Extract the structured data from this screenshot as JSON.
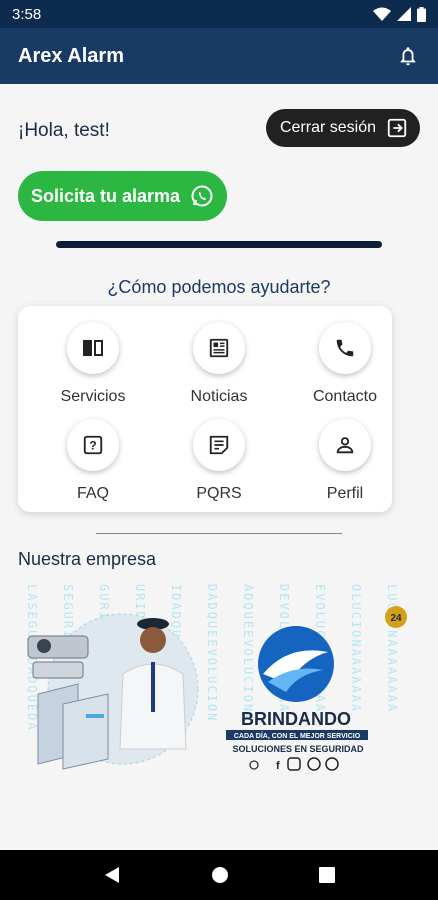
{
  "status_bar": {
    "time": "3:58"
  },
  "app_bar": {
    "title": "Arex Alarm"
  },
  "greeting": "¡Hola, test!",
  "logout_label": "Cerrar sesión",
  "alarm_button_label": "Solicita tu alarma",
  "help_title": "¿Cómo podemos ayudarte?",
  "grid": [
    {
      "label": "Servicios",
      "icon": "book-icon"
    },
    {
      "label": "Noticias",
      "icon": "newspaper-icon"
    },
    {
      "label": "Contacto",
      "icon": "phone-icon"
    },
    {
      "label": "FAQ",
      "icon": "question-icon"
    },
    {
      "label": "PQRS",
      "icon": "note-icon"
    },
    {
      "label": "Perfil",
      "icon": "person-icon"
    }
  ],
  "company_title": "Nuestra empresa",
  "banner": {
    "brand": "BRINDANDO",
    "tagline": "CADA DÍA, CON EL MEJOR SERVICIO",
    "subtitle": "SOLUCIONES EN SEGURIDAD",
    "badge": "24",
    "bg_text": "LASEGURIDADQUEDAEVOLUCIONA"
  },
  "colors": {
    "appbar": "#1a3a66",
    "statusbar": "#0d2a4f",
    "whatsapp_green": "#2bb741",
    "brand_blue": "#1565c0"
  }
}
